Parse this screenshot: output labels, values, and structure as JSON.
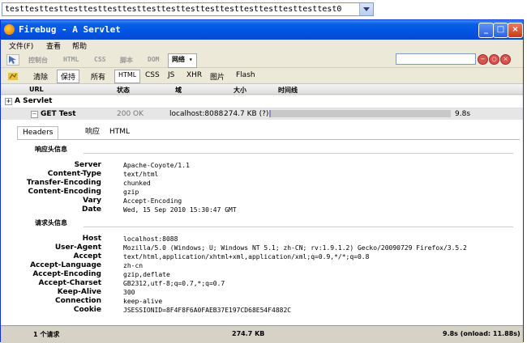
{
  "top_select": {
    "value": "testtesttesttesttesttesttesttesttesttesttesttesttesttesttesttesttest0"
  },
  "window": {
    "title": "Firebug - A Servlet",
    "menu": [
      "文件(F)",
      "查看",
      "帮助"
    ],
    "controls": {
      "minimize": "_",
      "maximize": "□",
      "close": "×"
    }
  },
  "toolbar1": {
    "tabs": [
      "控制台",
      "HTML",
      "CSS",
      "脚本",
      "DOM",
      "网络 ▾"
    ],
    "active": "网络 ▾",
    "search_value": ""
  },
  "toolbar2": {
    "items": [
      "清除",
      "保持",
      "所有",
      "HTML",
      "CSS",
      "JS",
      "XHR",
      "图片",
      "Flash"
    ],
    "selected": [
      "保持",
      "HTML"
    ]
  },
  "columns": {
    "url": "URL",
    "status": "状态",
    "domain": "域",
    "size": "大小",
    "timeline": "时间线"
  },
  "group": {
    "label": "A Servlet"
  },
  "request": {
    "method_url": "GET Test",
    "status": "200 OK",
    "domain": "localhost:8088",
    "size": "274.7 KB (?)",
    "time": "9.8s",
    "timeline_fraction": 0.01
  },
  "detail_tabs": [
    "Headers",
    "响应",
    "HTML"
  ],
  "response_headers": {
    "title": "响应头信息",
    "rows": [
      {
        "name": "Server",
        "value": "Apache-Coyote/1.1"
      },
      {
        "name": "Content-Type",
        "value": "text/html"
      },
      {
        "name": "Transfer-Encoding",
        "value": "chunked"
      },
      {
        "name": "Content-Encoding",
        "value": "gzip"
      },
      {
        "name": "Vary",
        "value": "Accept-Encoding"
      },
      {
        "name": "Date",
        "value": "Wed, 15 Sep 2010 15:30:47 GMT"
      }
    ]
  },
  "request_headers": {
    "title": "请求头信息",
    "rows": [
      {
        "name": "Host",
        "value": "localhost:8088"
      },
      {
        "name": "User-Agent",
        "value": "Mozilla/5.0 (Windows; U; Windows NT 5.1; zh-CN; rv:1.9.1.2) Gecko/20090729 Firefox/3.5.2"
      },
      {
        "name": "Accept",
        "value": "text/html,application/xhtml+xml,application/xml;q=0.9,*/*;q=0.8"
      },
      {
        "name": "Accept-Language",
        "value": "zh-cn"
      },
      {
        "name": "Accept-Encoding",
        "value": "gzip,deflate"
      },
      {
        "name": "Accept-Charset",
        "value": "GB2312,utf-8;q=0.7,*;q=0.7"
      },
      {
        "name": "Keep-Alive",
        "value": "300"
      },
      {
        "name": "Connection",
        "value": "keep-alive"
      },
      {
        "name": "Cookie",
        "value": "JSESSIONID=8F4F8F6A0FAEB37E197CD68E54F4882C"
      }
    ]
  },
  "status_bar": {
    "requests": "1 个请求",
    "total_size": "274.7 KB",
    "timing": "9.8s (onload: 11.88s)"
  },
  "colors": {
    "title_bar": "#0054e3",
    "timeline_bar": "#9b86c4",
    "window_bg": "#ece9d8"
  }
}
